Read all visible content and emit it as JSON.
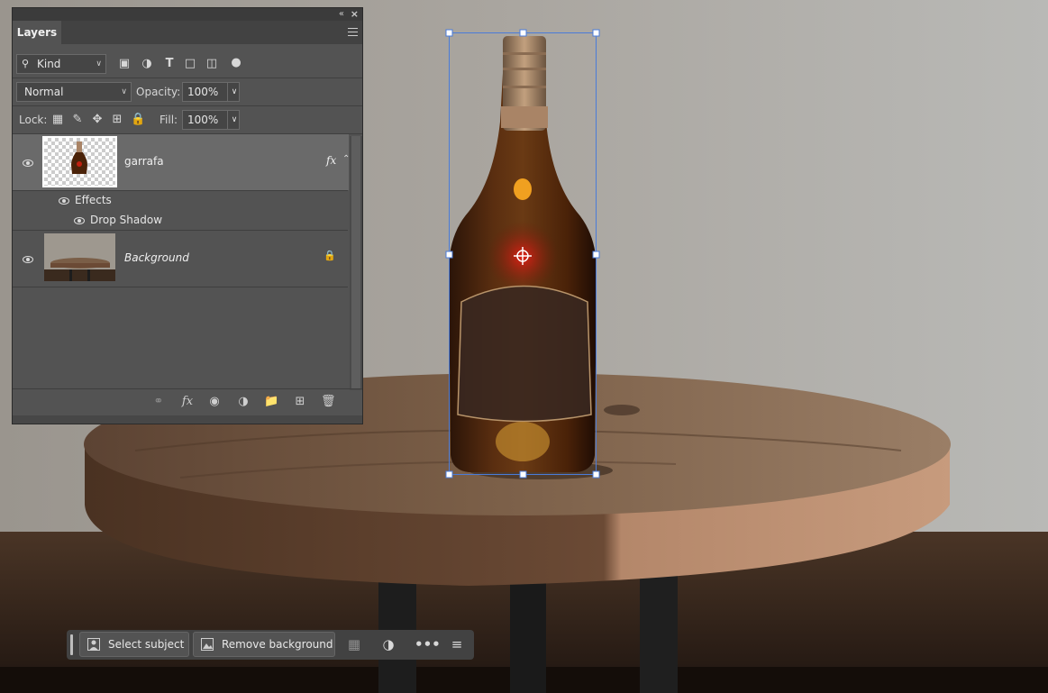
{
  "layers_panel": {
    "tab_label": "Layers",
    "filter": {
      "selected": "Kind"
    },
    "blend_mode": {
      "selected": "Normal"
    },
    "opacity": {
      "label": "Opacity:",
      "value": "100%"
    },
    "lock": {
      "label": "Lock:"
    },
    "fill": {
      "label": "Fill:",
      "value": "100%"
    },
    "layers": [
      {
        "name": "garrafa",
        "fx_label": "fx",
        "effects_label": "Effects",
        "effect_name": "Drop Shadow"
      },
      {
        "name": "Background"
      }
    ],
    "bottom_icons": [
      "link-icon",
      "fx-icon",
      "mask-icon",
      "adjustment-icon",
      "folder-icon",
      "new-layer-icon",
      "trash-icon"
    ]
  },
  "taskbar": {
    "select_subject": "Select subject",
    "remove_background": "Remove background"
  },
  "colors": {
    "panel_bg": "#535353",
    "selected_layer": "#6a6a6a",
    "bounding_box": "#4a7bd8"
  }
}
